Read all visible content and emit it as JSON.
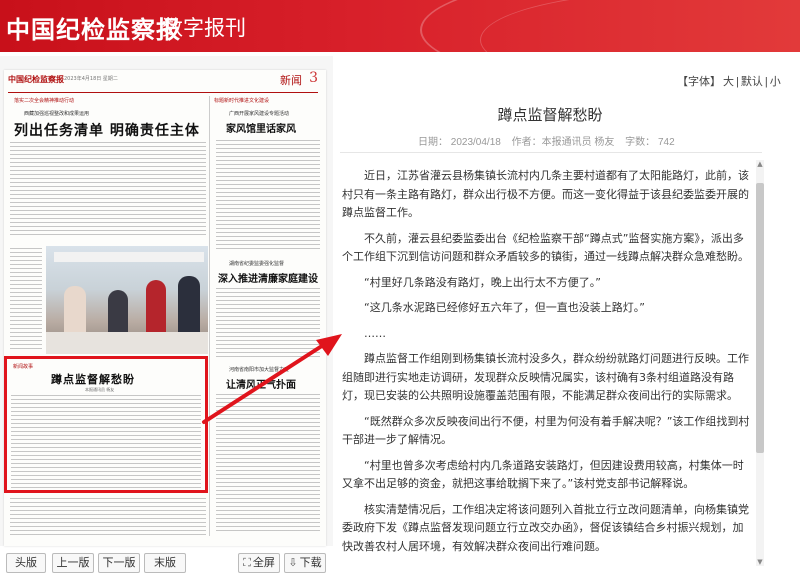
{
  "header": {
    "logo": "中国纪检监察报",
    "subtitle": "数字报刊"
  },
  "newspaper": {
    "masthead": "中国纪检监察报",
    "date_line": "2023年4月18日 星期二",
    "section_name": "新闻",
    "page_number": "3",
    "kicker_left": "落实二次全会精神推动行动",
    "kicker_left_sub": "西藏加强巡视整改和成果运用",
    "headline_left": "列出任务清单  明确责任主体",
    "kicker_right": "标题新时代推进文化建设",
    "subhead_right_1": "广西开展家风建设专题活动",
    "headline_right_1": "家风馆里话家风",
    "subhead_right_2": "湖南省纪委监委强化监督",
    "headline_right_2": "深入推进清廉家庭建设",
    "subhead_right_3": "河南省南阳市加大监督力度",
    "headline_right_3": "让清风正气扑面",
    "highlight_kicker": "新闻故事",
    "highlight_title": "蹲点监督解愁盼",
    "highlight_author": "本报通讯员 杨友"
  },
  "toolbar": {
    "first_page": "头版",
    "prev_page": "上一版",
    "next_page": "下一版",
    "last_page": "末版",
    "fullscreen": "全屏",
    "download": "下载"
  },
  "font_controls": {
    "label": "【字体】",
    "large": "大",
    "default": "默认",
    "small": "小",
    "sep": "|"
  },
  "article": {
    "title": "蹲点监督解愁盼",
    "date_label": "日期： 2023/04/18",
    "author_label": "作者：本报通讯员 杨友",
    "wordcount_label": "字数： 742",
    "paragraphs": [
      "近日，江苏省灌云县杨集镇长流村内几条主要村道都有了太阳能路灯，此前，该村只有一条主路有路灯，群众出行极不方便。而这一变化得益于该县纪委监委开展的蹲点监督工作。",
      "不久前，灌云县纪委监委出台《纪检监察干部“蹲点式”监督实施方案》，派出多个工作组下沉到信访问题和群众矛盾较多的镇街，通过一线蹲点解决群众急难愁盼。",
      "“村里好几条路没有路灯，晚上出行太不方便了。”",
      "“这几条水泥路已经修好五六年了，但一直也没装上路灯。”",
      "……",
      "蹲点监督工作组刚到杨集镇长流村没多久，群众纷纷就路灯问题进行反映。工作组随即进行实地走访调研，发现群众反映情况属实，该村确有3条村组道路没有路灯，现已安装的公共照明设施覆盖范围有限，不能满足群众夜间出行的实际需求。",
      "“既然群众多次反映夜间出行不便，村里为何没有着手解决呢？”该工作组找到村干部进一步了解情况。",
      "“村里也曾多次考虑给村内几条道路安装路灯，但因建设费用较高，村集体一时又拿不出足够的资金，就把这事给耽搁下来了。”该村党支部书记解释说。",
      "核实清楚情况后，工作组决定将该问题列入首批立行立改问题清单，向杨集镇党委政府下发《蹲点监督发现问题立行立改交办函》，督促该镇结合乡村振兴规划，加快改善农村人居环境，有效解决群众夜间出行难问题。"
    ]
  },
  "colors": {
    "brand_red": "#d8202a",
    "highlight_red": "#e0141c"
  }
}
